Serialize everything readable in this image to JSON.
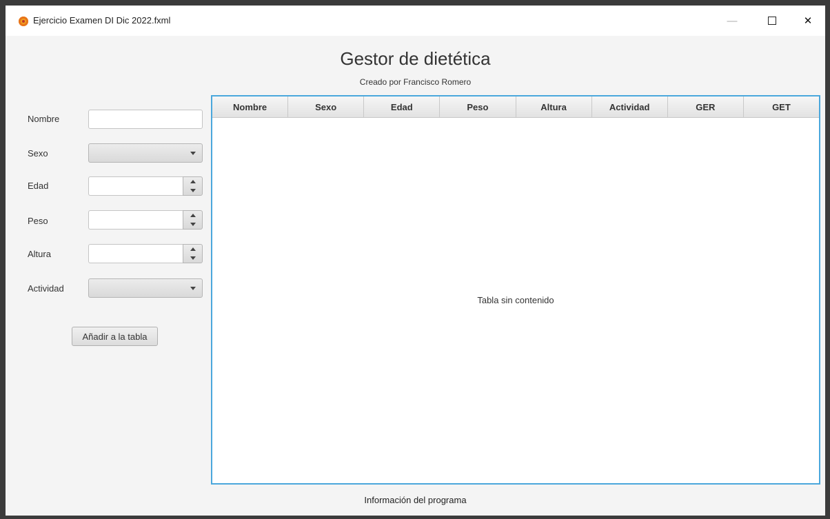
{
  "window": {
    "title": "Ejercicio Examen DI Dic 2022.fxml",
    "controls": {
      "minimize": "—",
      "close": "✕"
    }
  },
  "header": {
    "title": "Gestor de dietética",
    "subtitle": "Creado por Francisco Romero"
  },
  "form": {
    "nombre_label": "Nombre",
    "sexo_label": "Sexo",
    "edad_label": "Edad",
    "peso_label": "Peso",
    "altura_label": "Altura",
    "actividad_label": "Actividad",
    "nombre_value": "",
    "edad_value": "",
    "peso_value": "",
    "altura_value": "",
    "add_button": "Añadir a la tabla"
  },
  "table": {
    "columns": [
      "Nombre",
      "Sexo",
      "Edad",
      "Peso",
      "Altura",
      "Actividad",
      "GER",
      "GET"
    ],
    "empty_text": "Tabla sin contenido",
    "accent": "#4aa7dc"
  },
  "footer": {
    "text": "Información del programa"
  }
}
